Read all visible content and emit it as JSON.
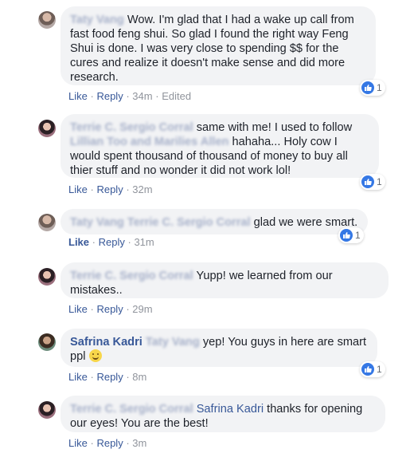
{
  "comments": [
    {
      "author": "Taty Vang",
      "text": "Wow. I'm glad that I had a wake up call from fast food feng shui. So glad I found the right way Feng Shui is done. I was very close to spending $$ for the cures and realize it doesn't make sense and did more research.",
      "like": "Like",
      "reply": "Reply",
      "time": "34m",
      "edited": "Edited",
      "reactions": "1"
    },
    {
      "author": "Terrie C. Sergio Corral",
      "text_before": "same with me! I used to follow",
      "tag": "Lillian Too and Marilies Allen",
      "text_after": "hahaha... Holy cow I would spent thousand of thousand of money to buy all thier stuff and no wonder it did not work lol!",
      "like": "Like",
      "reply": "Reply",
      "time": "32m",
      "reactions": "1"
    },
    {
      "author": "Taty Vang",
      "tag": "Terrie C. Sergio Corral",
      "text": "glad we were smart.",
      "like": "Like",
      "reply": "Reply",
      "time": "31m",
      "reactions": "1"
    },
    {
      "author": "Terrie C. Sergio Corral",
      "text": "Yupp! we learned from our mistakes..",
      "like": "Like",
      "reply": "Reply",
      "time": "29m"
    },
    {
      "author": "Safrina Kadri",
      "tag": "Taty Vang",
      "text": "yep! You guys in here are smart ppl",
      "like": "Like",
      "reply": "Reply",
      "time": "8m",
      "reactions": "1"
    },
    {
      "author": "Terrie C. Sergio Corral",
      "mention": "Safrina Kadri",
      "text": "thanks for opening our eyes! You are the best!",
      "like": "Like",
      "reply": "Reply",
      "time": "3m"
    }
  ]
}
